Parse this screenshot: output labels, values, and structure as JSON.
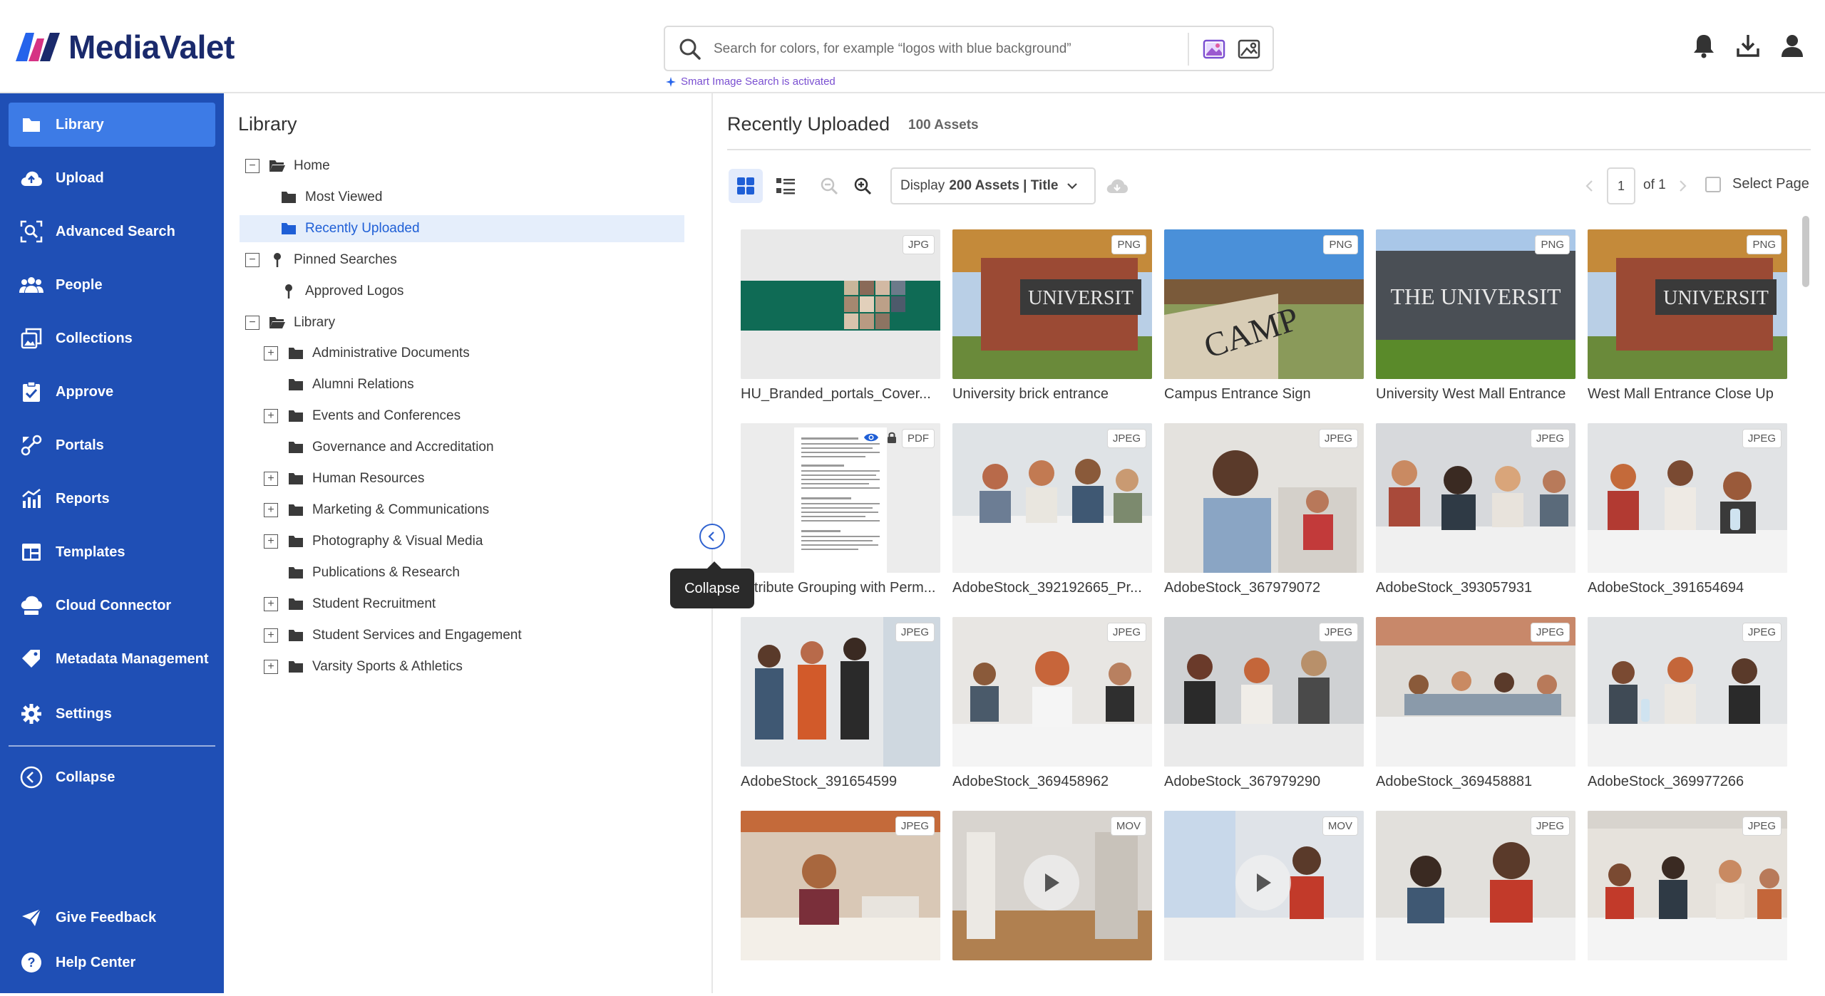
{
  "app": {
    "brand": "MediaValet",
    "search_placeholder": "Search for colors, for example “logos with blue background”",
    "smart_search_note": "Smart Image Search is activated"
  },
  "sidebar": {
    "items": [
      {
        "label": "Library",
        "icon": "folder-icon",
        "active": true
      },
      {
        "label": "Upload",
        "icon": "cloud-upload-icon"
      },
      {
        "label": "Advanced Search",
        "icon": "advanced-search-icon"
      },
      {
        "label": "People",
        "icon": "people-icon"
      },
      {
        "label": "Collections",
        "icon": "collections-icon"
      },
      {
        "label": "Approve",
        "icon": "approve-icon"
      },
      {
        "label": "Portals",
        "icon": "portals-icon"
      },
      {
        "label": "Reports",
        "icon": "reports-icon"
      },
      {
        "label": "Templates",
        "icon": "templates-icon"
      },
      {
        "label": "Cloud Connector",
        "icon": "cloud-connector-icon"
      },
      {
        "label": "Metadata Management",
        "icon": "metadata-icon"
      },
      {
        "label": "Settings",
        "icon": "gear-icon"
      }
    ],
    "collapse_label": "Collapse",
    "feedback_label": "Give Feedback",
    "help_label": "Help Center"
  },
  "tree": {
    "title": "Library",
    "rows": [
      {
        "label": "Home"
      },
      {
        "label": "Most Viewed"
      },
      {
        "label": "Recently Uploaded"
      },
      {
        "label": "Pinned Searches"
      },
      {
        "label": "Approved Logos"
      },
      {
        "label": "Library"
      },
      {
        "label": "Administrative Documents"
      },
      {
        "label": "Alumni Relations"
      },
      {
        "label": "Events and Conferences"
      },
      {
        "label": "Governance and Accreditation"
      },
      {
        "label": "Human Resources"
      },
      {
        "label": "Marketing & Communications"
      },
      {
        "label": "Photography & Visual Media"
      },
      {
        "label": "Publications & Research"
      },
      {
        "label": "Student Recruitment"
      },
      {
        "label": "Student Services and Engagement"
      },
      {
        "label": "Varsity Sports & Athletics"
      }
    ],
    "tooltip": "Collapse"
  },
  "main": {
    "title": "Recently Uploaded",
    "count": "100 Assets",
    "display_prefix": "Display",
    "display_value": "200 Assets | Title",
    "page_current": "1",
    "page_of": "of 1",
    "select_page": "Select Page"
  },
  "assets": [
    {
      "label": "HU_Branded_portals_Cover...",
      "type": "JPG"
    },
    {
      "label": "University brick entrance",
      "type": "PNG"
    },
    {
      "label": "Campus Entrance Sign",
      "type": "PNG"
    },
    {
      "label": "University West Mall Entrance",
      "type": "PNG"
    },
    {
      "label": "West Mall Entrance Close Up",
      "type": "PNG"
    },
    {
      "label": "Attribute Grouping with Perm...",
      "type": "PDF"
    },
    {
      "label": "AdobeStock_392192665_Pr...",
      "type": "JPEG"
    },
    {
      "label": "AdobeStock_367979072",
      "type": "JPEG"
    },
    {
      "label": "AdobeStock_393057931",
      "type": "JPEG"
    },
    {
      "label": "AdobeStock_391654694",
      "type": "JPEG"
    },
    {
      "label": "AdobeStock_391654599",
      "type": "JPEG"
    },
    {
      "label": "AdobeStock_369458962",
      "type": "JPEG"
    },
    {
      "label": "AdobeStock_367979290",
      "type": "JPEG"
    },
    {
      "label": "AdobeStock_369458881",
      "type": "JPEG"
    },
    {
      "label": "AdobeStock_369977266",
      "type": "JPEG"
    },
    {
      "label": "",
      "type": "JPEG"
    },
    {
      "label": "",
      "type": "MOV"
    },
    {
      "label": "",
      "type": "MOV"
    },
    {
      "label": "",
      "type": "JPEG"
    },
    {
      "label": "",
      "type": "JPEG"
    }
  ],
  "colors": {
    "sidebar": "#1f4fb5",
    "sidebar_active": "#3d7be6",
    "accent": "#1f5fd6",
    "brand_navy": "#1a2a6c"
  }
}
